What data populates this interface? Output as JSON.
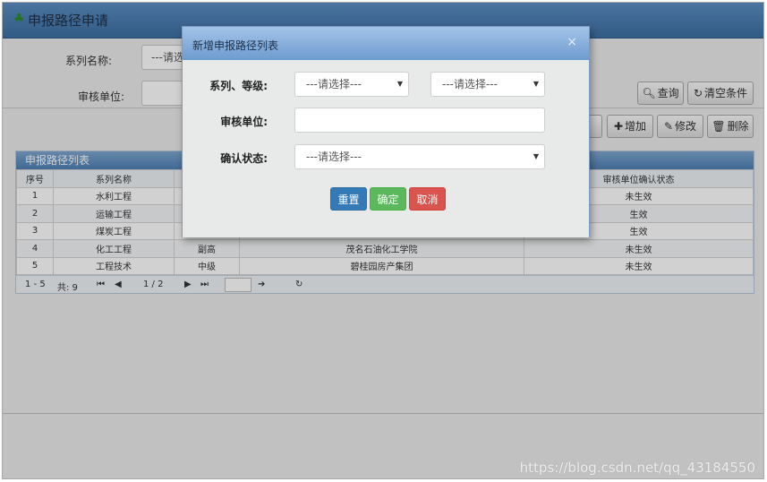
{
  "page": {
    "title": "申报路径申请",
    "tree_icon": "tree-icon"
  },
  "search": {
    "series_label": "系列名称:",
    "series_value": "---请选",
    "review_unit_label": "审核单位:",
    "review_unit_value": ""
  },
  "toolbar": {
    "query_label": "查询",
    "clear_label": "清空条件",
    "add_label": "增加",
    "edit_label": "修改",
    "delete_label": "删除"
  },
  "grid": {
    "caption": "申报路径列表",
    "columns": [
      "序号",
      "系列名称",
      "",
      "",
      "审核单位确认状态"
    ],
    "rows": [
      [
        "1",
        "水利工程",
        "",
        "",
        "未生效"
      ],
      [
        "2",
        "运输工程",
        "",
        "",
        "生效"
      ],
      [
        "3",
        "煤炭工程",
        "",
        "",
        "生效"
      ],
      [
        "4",
        "化工工程",
        "副高",
        "茂名石油化工学院",
        "未生效"
      ],
      [
        "5",
        "工程技术",
        "中级",
        "碧桂园房产集团",
        "未生效"
      ]
    ],
    "pager": {
      "range": "1 - 5",
      "total": "共: 9",
      "page": "1 / 2"
    }
  },
  "modal": {
    "title": "新增申报路径列表",
    "close": "×",
    "series_grade_label": "系列、等级:",
    "series_select": "---请选择---",
    "grade_select": "---请选择---",
    "review_unit_label": "审核单位:",
    "review_unit_value": "",
    "confirm_status_label": "确认状态:",
    "confirm_status_select": "---请选择---",
    "reset_label": "重置",
    "ok_label": "确定",
    "cancel_label": "取消"
  },
  "watermark": "https://blog.csdn.net/qq_43184550",
  "colors": {
    "header_blue": "#4a7eb3",
    "btn_reset": "#337ab7",
    "btn_ok": "#5cb85c",
    "btn_cancel": "#d9534f"
  }
}
